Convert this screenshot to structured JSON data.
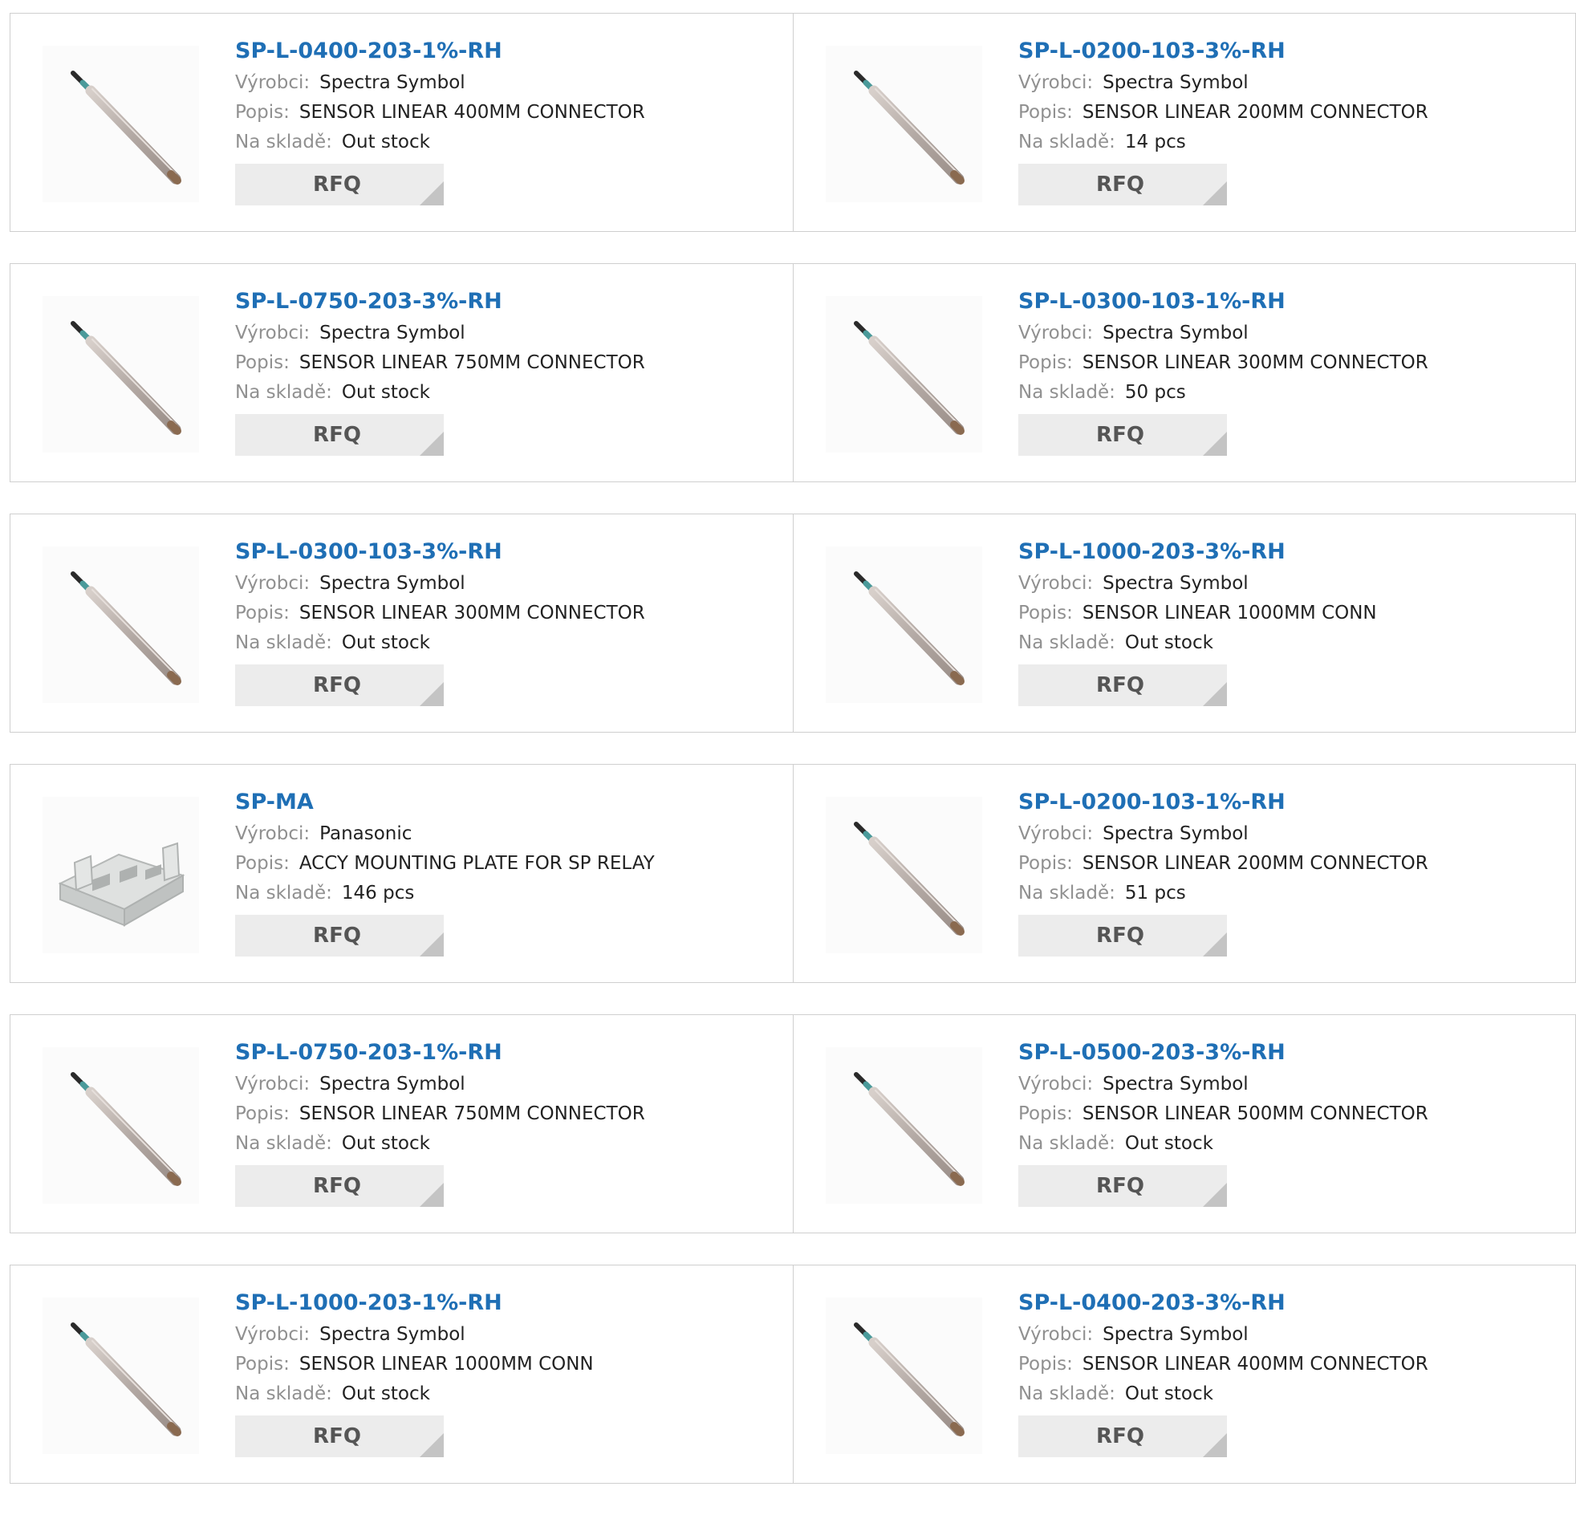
{
  "labels": {
    "manufacturer": "Výrobci:",
    "description": "Popis:",
    "stock": "Na skladě:",
    "rfq": "RFQ"
  },
  "colors": {
    "title_link": "#1f6fb5",
    "label_gray": "#909090",
    "value_dark": "#222222",
    "button_bg": "#ececec",
    "button_text": "#555555",
    "border": "#cfcfcf"
  },
  "products": [
    {
      "part": "SP-L-0400-203-1%-RH",
      "manufacturer": "Spectra Symbol",
      "description": "SENSOR LINEAR 400MM CONNECTOR",
      "stock": "Out stock",
      "image": "linear-sensor-icon"
    },
    {
      "part": "SP-L-0200-103-3%-RH",
      "manufacturer": "Spectra Symbol",
      "description": "SENSOR LINEAR 200MM CONNECTOR",
      "stock": "14 pcs",
      "image": "linear-sensor-icon"
    },
    {
      "part": "SP-L-0750-203-3%-RH",
      "manufacturer": "Spectra Symbol",
      "description": "SENSOR LINEAR 750MM CONNECTOR",
      "stock": "Out stock",
      "image": "linear-sensor-icon"
    },
    {
      "part": "SP-L-0300-103-1%-RH",
      "manufacturer": "Spectra Symbol",
      "description": "SENSOR LINEAR 300MM CONNECTOR",
      "stock": "50 pcs",
      "image": "linear-sensor-icon"
    },
    {
      "part": "SP-L-0300-103-3%-RH",
      "manufacturer": "Spectra Symbol",
      "description": "SENSOR LINEAR 300MM CONNECTOR",
      "stock": "Out stock",
      "image": "linear-sensor-icon"
    },
    {
      "part": "SP-L-1000-203-3%-RH",
      "manufacturer": "Spectra Symbol",
      "description": "SENSOR LINEAR 1000MM CONN",
      "stock": "Out stock",
      "image": "linear-sensor-icon"
    },
    {
      "part": "SP-MA",
      "manufacturer": "Panasonic",
      "description": "ACCY MOUNTING PLATE FOR SP RELAY",
      "stock": "146 pcs",
      "image": "mounting-plate-icon"
    },
    {
      "part": "SP-L-0200-103-1%-RH",
      "manufacturer": "Spectra Symbol",
      "description": "SENSOR LINEAR 200MM CONNECTOR",
      "stock": "51 pcs",
      "image": "linear-sensor-icon"
    },
    {
      "part": "SP-L-0750-203-1%-RH",
      "manufacturer": "Spectra Symbol",
      "description": "SENSOR LINEAR 750MM CONNECTOR",
      "stock": "Out stock",
      "image": "linear-sensor-icon"
    },
    {
      "part": "SP-L-0500-203-3%-RH",
      "manufacturer": "Spectra Symbol",
      "description": "SENSOR LINEAR 500MM CONNECTOR",
      "stock": "Out stock",
      "image": "linear-sensor-icon"
    },
    {
      "part": "SP-L-1000-203-1%-RH",
      "manufacturer": "Spectra Symbol",
      "description": "SENSOR LINEAR 1000MM CONN",
      "stock": "Out stock",
      "image": "linear-sensor-icon"
    },
    {
      "part": "SP-L-0400-203-3%-RH",
      "manufacturer": "Spectra Symbol",
      "description": "SENSOR LINEAR 400MM CONNECTOR",
      "stock": "Out stock",
      "image": "linear-sensor-icon"
    }
  ]
}
